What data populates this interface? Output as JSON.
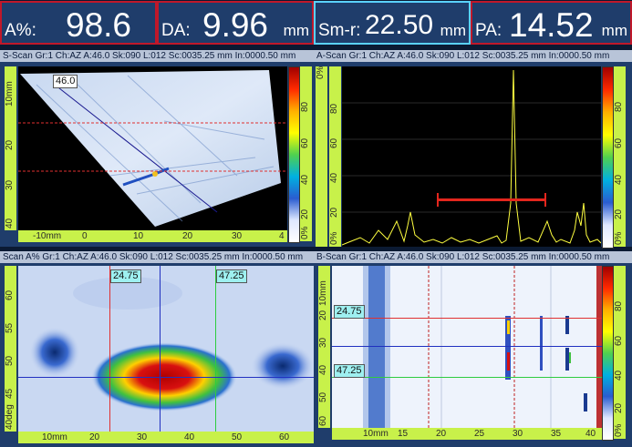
{
  "readouts": [
    {
      "label": "A%:",
      "value": "98.6",
      "unit": ""
    },
    {
      "label": "DA:",
      "value": "9.96",
      "unit": "mm"
    },
    {
      "label": "Sm-r:",
      "value": "22.50",
      "unit": "mm"
    },
    {
      "label": "PA:",
      "value": "14.52",
      "unit": "mm"
    }
  ],
  "panels": {
    "sscan": {
      "title": "S-Scan Gr:1 Ch:AZ A:46.0 Sk:090 L:012 Sc:0035.25 mm In:0000.50 mm",
      "angle_label": "46.0"
    },
    "ascan": {
      "title": "A-Scan Gr:1 Ch:AZ A:46.0 Sk:090 L:012 Sc:0035.25 mm In:0000.50 mm"
    },
    "cscan": {
      "title": "Scan A% Gr:1 Ch:AZ A:46.0 Sk:090 L:012 Sc:0035.25 mm In:0000.50 mm",
      "cursor1": "24.75",
      "cursor2": "47.25"
    },
    "bscan": {
      "title": "B-Scan Gr:1 Ch:AZ A:46.0 Sk:090 L:012 Sc:0035.25 mm In:0000.50 mm",
      "cursor1": "24.75",
      "cursor2": "47.25"
    }
  },
  "rulers": {
    "sscan_v": [
      "10mm",
      "20",
      "30",
      "40"
    ],
    "sscan_h": [
      "-10mm",
      "0",
      "10",
      "20",
      "30",
      "4"
    ],
    "ascan_v": [
      "80",
      "60",
      "40",
      "20",
      "0%"
    ],
    "ascan_v_prefix": [
      "0%"
    ],
    "cscan_v": [
      "60",
      "55",
      "50",
      "45",
      "40deg"
    ],
    "cscan_h": [
      "10mm",
      "20",
      "30",
      "40",
      "50",
      "60"
    ],
    "bscan_v": [
      "10mm",
      "20",
      "30",
      "40",
      "50",
      "60"
    ],
    "bscan_h": [
      "10mm",
      "15",
      "20",
      "25",
      "30",
      "35",
      "40"
    ],
    "color_percent": [
      "80",
      "60",
      "40",
      "20",
      "0%"
    ]
  },
  "colors": {
    "cursor_red": "#e03030",
    "cursor_green": "#2ecc40",
    "cursor_blue": "#2030c0",
    "signal": "#ffff40",
    "gate": "#e3261d"
  }
}
